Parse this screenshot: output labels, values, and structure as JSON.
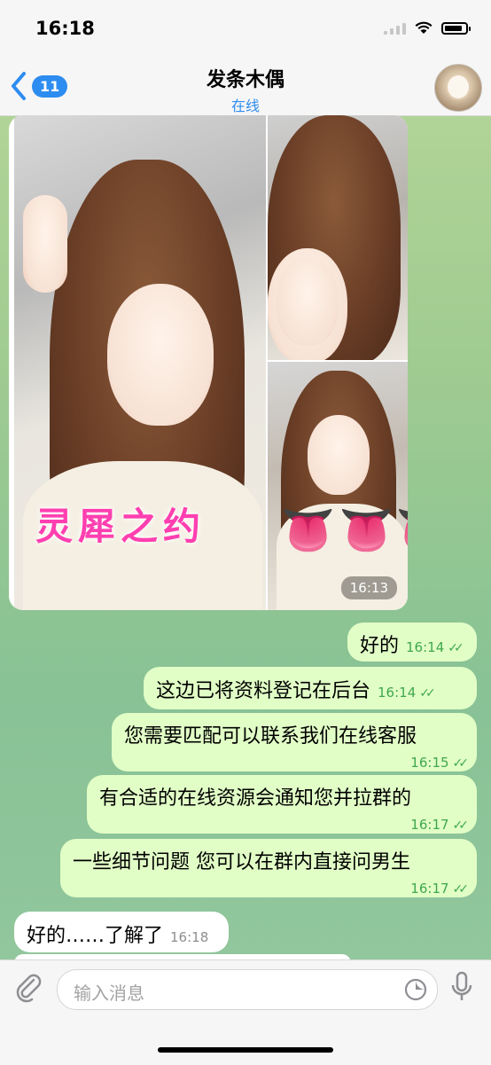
{
  "status_bar": {
    "time": "16:18"
  },
  "header": {
    "back_badge": "11",
    "title": "发条木偶",
    "subtitle": "在线"
  },
  "album": {
    "overlay_text": "灵犀之约",
    "timestamp": "16:13"
  },
  "messages": [
    {
      "text": "好的",
      "time": "16:14",
      "direction": "out"
    },
    {
      "text": "这边已将资料登记在后台",
      "time": "16:14",
      "direction": "out"
    },
    {
      "text": "您需要匹配可以联系我们在线客服",
      "time": "16:15",
      "direction": "out"
    },
    {
      "text": "有合适的在线资源会通知您并拉群的",
      "time": "16:17",
      "direction": "out"
    },
    {
      "text": "一些细节问题 您可以在群内直接问男生",
      "time": "16:17",
      "direction": "out"
    },
    {
      "text": "好的……了解了",
      "time": "16:18",
      "direction": "in"
    }
  ],
  "composer": {
    "placeholder": "输入消息"
  },
  "icons": {
    "back": "chevron-left-icon",
    "attach": "paperclip-icon",
    "sticker": "sticker-icon",
    "mic": "microphone-icon",
    "wifi": "wifi-icon",
    "battery": "battery-icon",
    "read": "double-check-icon"
  },
  "colors": {
    "accent": "#2d8cf0",
    "outgoing_bubble": "#e1fec6",
    "read_tick": "#3fa84e"
  }
}
